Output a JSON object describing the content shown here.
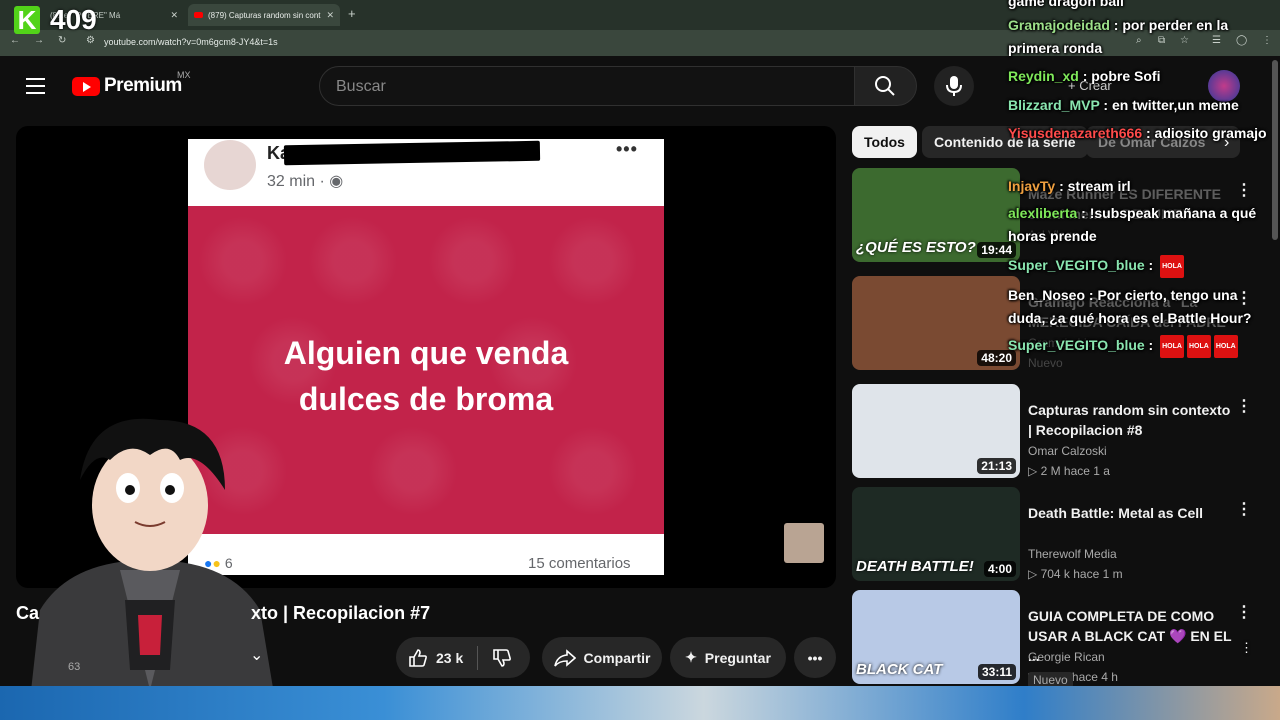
{
  "browser": {
    "tabs": [
      {
        "label": "(8...er \"POBRE\" Má",
        "active": false
      },
      {
        "label": "(879) Capturas random sin cont",
        "active": true
      }
    ],
    "new_tab": "+",
    "url": "youtube.com/watch?v=0m6gcm8-JY4&t=1s"
  },
  "stream": {
    "counter_icon": "K",
    "counter": "409"
  },
  "header": {
    "logo_text": "Premium",
    "region": "MX",
    "search_placeholder": "Buscar",
    "create_label": "Crear"
  },
  "post": {
    "name": "Ka",
    "time": "32 min · ",
    "line1": "Alguien que venda",
    "line2": "dulces de broma",
    "reactions": "6",
    "comments": "15 comentarios",
    "more": "•••"
  },
  "video": {
    "title_start": "Ca",
    "title_end": "xto | Recopilacion #7",
    "subs_partial": "63",
    "likes": "23 k",
    "share": "Compartir",
    "ask": "Preguntar"
  },
  "chips": [
    "Todos",
    "Contenido de la serie",
    "De Omar Calzos"
  ],
  "recommendations": [
    {
      "title": "Maze Runner ES DIFERENTE en mi mente - RESUMEN",
      "channel": "Acl.Vlogs",
      "meta": "",
      "duration": "19:44",
      "thumb_color": "#3c6a2f",
      "caption": "¿QUÉ ES ESTO?"
    },
    {
      "title": "Gramajo Reacciona a \"La MERECIDA CAÍDA del PADRE ...",
      "channel": "Gramajo Live",
      "meta": "Nuevo",
      "duration": "48:20",
      "thumb_color": "#7a4a32",
      "caption": ""
    },
    {
      "title": "Capturas random sin contexto | Recopilacion #8",
      "channel": "Omar Calzoski",
      "meta": "▷ 2 M   hace 1 a",
      "duration": "21:13",
      "thumb_color": "#dfe4ea",
      "caption": ""
    },
    {
      "title": "Death Battle: Metal as Cell",
      "channel": "Therewolf Media",
      "meta": "▷ 704 k   hace 1 m",
      "duration": "4:00",
      "thumb_color": "#1e2a24",
      "caption": "DEATH BATTLE!"
    },
    {
      "title": "GUIA COMPLETA DE COMO USAR A BLACK CAT 💜 EN EL ...",
      "channel": "Georgie Rican",
      "meta": "▷ 1.8 K   hace 4 h",
      "duration": "33:11",
      "thumb_color": "#b8c9e6",
      "caption": "BLACK CAT",
      "badge": "Nuevo"
    }
  ],
  "chat": [
    {
      "user": "",
      "text": "game dragon ball",
      "color": "#ffffff"
    },
    {
      "user": "Gramajodeidad",
      "text": " : por perder en la primera ronda",
      "color": "#9de08a"
    },
    {
      "user": "Reydin_xd",
      "text": " : pobre Sofi",
      "color": "#7fe85a"
    },
    {
      "user": "Blizzard_MVP",
      "text": " : en twitter,un meme",
      "color": "#8ae6b0"
    },
    {
      "user": "Yisusdenazareth666",
      "text": " : adiosito gramajo",
      "color": "#ff4b4b"
    },
    {
      "user": "InjavTy",
      "text": " : stream irl",
      "color": "#f0a040"
    },
    {
      "user": "alexliberta",
      "text": " : !subspeak mañana a qué horas prende",
      "color": "#7fe85a"
    },
    {
      "user": "Super_VEGITO_blue",
      "text": " : ",
      "color": "#8ae6b0"
    },
    {
      "user": "Ben_Noseo",
      "text": " : Por cierto, tengo una duda, ¿a qué hora es el Battle Hour?",
      "color": "#ffffff"
    },
    {
      "user": "Super_VEGITO_blue",
      "text": " : ",
      "color": "#8ae6b0"
    }
  ],
  "chat_badge": "HOLA"
}
